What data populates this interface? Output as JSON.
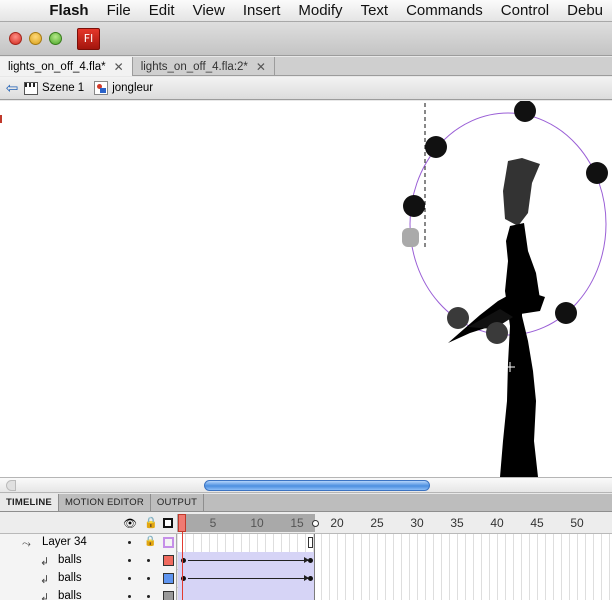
{
  "menubar": {
    "apple": "",
    "items": [
      "Flash",
      "File",
      "Edit",
      "View",
      "Insert",
      "Modify",
      "Text",
      "Commands",
      "Control",
      "Debu"
    ]
  },
  "app": {
    "logo": "Fl"
  },
  "doc_tabs": [
    {
      "label": "lights_on_off_4.fla*",
      "close": "✕",
      "active": true
    },
    {
      "label": "lights_on_off_4.fla:2*",
      "close": "✕",
      "active": false
    }
  ],
  "editbar": {
    "scene": "Szene 1",
    "symbol": "jongleur"
  },
  "panel_tabs": [
    "TIMELINE",
    "MOTION EDITOR",
    "OUTPUT"
  ],
  "timeline": {
    "ruler": [
      "5",
      "10",
      "15",
      "20",
      "25",
      "30",
      "35",
      "40",
      "45",
      "50"
    ],
    "layers": [
      {
        "name": "Layer 34",
        "type": "motion-guide",
        "color": "#c58fe8",
        "locked": true
      },
      {
        "name": "balls",
        "type": "guided",
        "color": "#f06a5e",
        "locked": false
      },
      {
        "name": "balls",
        "type": "guided",
        "color": "#5f95f0",
        "locked": false
      },
      {
        "name": "balls",
        "type": "guided",
        "color": "#999999",
        "locked": false
      }
    ]
  },
  "colors": {
    "guide_path": "#9a5fd6",
    "playhead": "#e23b30",
    "scroll_thumb": "#4c8fe0"
  }
}
